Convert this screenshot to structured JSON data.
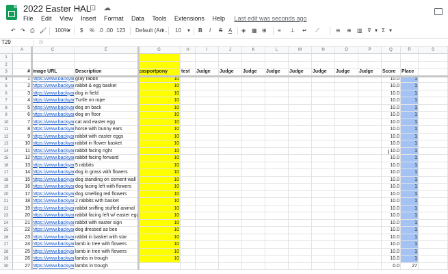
{
  "doc": {
    "title": "2022 Easter HAL",
    "menus": [
      "File",
      "Edit",
      "View",
      "Insert",
      "Format",
      "Data",
      "Tools",
      "Extensions",
      "Help"
    ],
    "last_edit": "Last edit was seconds ago"
  },
  "toolbar": {
    "zoom": "100%",
    "currency": "$",
    "percent": "%",
    "decimal_decrease": ".0",
    "decimal_increase": ".00",
    "more_formats": "123",
    "font": "Default (Ari...",
    "font_size": "10"
  },
  "formula_bar": {
    "name_box": "T29",
    "fx": "fx",
    "value": ""
  },
  "columns": [
    "A",
    "C",
    "E",
    "G",
    "H",
    "I",
    "J",
    "K",
    "L",
    "M",
    "N",
    "O",
    "P",
    "Q",
    "R",
    "S"
  ],
  "headers": [
    "#",
    "Image URL",
    "Description",
    "casportpony",
    "test",
    "Judge",
    "Judge",
    "Judge",
    "Judge",
    "Judge",
    "Judge",
    "Judge",
    "Judge",
    "Score",
    "Place"
  ],
  "rows": [
    {
      "row": "1"
    },
    {
      "row": "2"
    },
    {
      "row": "4",
      "n": "1",
      "url": "https://www.backyar",
      "desc": "gray rabbit",
      "cas": "10",
      "score": "10.0",
      "place": "1"
    },
    {
      "row": "5",
      "n": "2",
      "url": "https://www.backyar",
      "desc": "rabbit & egg basket",
      "cas": "10",
      "score": "10.0",
      "place": "1"
    },
    {
      "row": "6",
      "n": "3",
      "url": "https://www.backyar",
      "desc": "dog in field",
      "cas": "10",
      "score": "10.0",
      "place": "1"
    },
    {
      "row": "7",
      "n": "4",
      "url": "https://www.backyar",
      "desc": "Turtle on rope",
      "cas": "10",
      "score": "10.0",
      "place": "1"
    },
    {
      "row": "8",
      "n": "5",
      "url": "https://www.backyar",
      "desc": "dog on back",
      "cas": "10",
      "score": "10.0",
      "place": "1"
    },
    {
      "row": "9",
      "n": "6",
      "url": "https://www.backyar",
      "desc": "dog on floor",
      "cas": "10",
      "score": "10.0",
      "place": "1"
    },
    {
      "row": "10",
      "n": "7",
      "url": "https://www.backyar",
      "desc": "cat and easter egg",
      "cas": "10",
      "score": "10.0",
      "place": "1"
    },
    {
      "row": "11",
      "n": "8",
      "url": "https://www.backyar",
      "desc": "horse with bunny ears",
      "cas": "10",
      "score": "10.0",
      "place": "1"
    },
    {
      "row": "12",
      "n": "9",
      "url": "https://www.backyar",
      "desc": "rabbit with easter eggs",
      "cas": "10",
      "score": "10.0",
      "place": "1"
    },
    {
      "row": "13",
      "n": "10",
      "url": "https://www.backyar",
      "desc": "rabbit in flower basket",
      "cas": "10",
      "score": "10.0",
      "place": "1"
    },
    {
      "row": "14",
      "n": "11",
      "url": "https://www.backyar",
      "desc": "rabbit facing right",
      "cas": "10",
      "score": "10.0",
      "place": "1"
    },
    {
      "row": "15",
      "n": "12",
      "url": "https://www.backyar",
      "desc": "rabbit facing forward",
      "cas": "10",
      "score": "10.0",
      "place": "1"
    },
    {
      "row": "16",
      "n": "13",
      "url": "https://www.backyar",
      "desc": "5 rabbits",
      "cas": "10",
      "score": "10.0",
      "place": "1"
    },
    {
      "row": "17",
      "n": "14",
      "url": "https://www.backyar",
      "desc": "dog in grass with flowers",
      "cas": "10",
      "score": "10.0",
      "place": "1"
    },
    {
      "row": "18",
      "n": "15",
      "url": "https://www.backyar",
      "desc": "dog standing on cement wall",
      "cas": "10",
      "score": "10.0",
      "place": "1"
    },
    {
      "row": "19",
      "n": "16",
      "url": "https://www.backyar",
      "desc": "dog facing left with flowers",
      "cas": "10",
      "score": "10.0",
      "place": "1"
    },
    {
      "row": "20",
      "n": "17",
      "url": "https://www.backyar",
      "desc": "dog smelling red flowers",
      "cas": "10",
      "score": "10.0",
      "place": "1"
    },
    {
      "row": "21",
      "n": "18",
      "url": "https://www.backyar",
      "desc": "2 rabbits with basket",
      "cas": "10",
      "score": "10.0",
      "place": "1"
    },
    {
      "row": "22",
      "n": "19",
      "url": "https://www.backyar",
      "desc": "rabbit sniffing stuffed animal",
      "cas": "10",
      "score": "10.0",
      "place": "1"
    },
    {
      "row": "23",
      "n": "20",
      "url": "https://www.backyar",
      "desc": "rabbit facing left w/ easter egg",
      "cas": "10",
      "score": "10.0",
      "place": "1"
    },
    {
      "row": "24",
      "n": "21",
      "url": "https://www.backyar",
      "desc": "rabbit with easter sign",
      "cas": "10",
      "score": "10.0",
      "place": "1"
    },
    {
      "row": "25",
      "n": "22",
      "url": "https://www.backyar",
      "desc": "dog dressed as bee",
      "cas": "10",
      "score": "10.0",
      "place": "1"
    },
    {
      "row": "26",
      "n": "23",
      "url": "https://www.backyar",
      "desc": "rabbit in basket with star",
      "cas": "10",
      "score": "10.0",
      "place": "1"
    },
    {
      "row": "27",
      "n": "24",
      "url": "https://www.backyar",
      "desc": "lamb in tree with flowers",
      "cas": "10",
      "score": "10.0",
      "place": "1"
    },
    {
      "row": "28",
      "n": "25",
      "url": "https://www.backyar",
      "desc": "lamb in tree with flowers",
      "cas": "10",
      "score": "10.0",
      "place": "1"
    },
    {
      "row": "29",
      "n": "26",
      "url": "https://www.backyar",
      "desc": "lambs in trough",
      "cas": "10",
      "score": "10.0",
      "place": "1"
    },
    {
      "row": "30",
      "n": "27",
      "url": "https://www.backyar",
      "desc": "lambs in trough",
      "cas": "",
      "score": "0.0",
      "place": "27"
    }
  ],
  "colors": {
    "highlight_yellow": "#ffff00",
    "place_blue": "#a4c2f4",
    "link": "#1155cc",
    "logo_green": "#0f9d58"
  }
}
